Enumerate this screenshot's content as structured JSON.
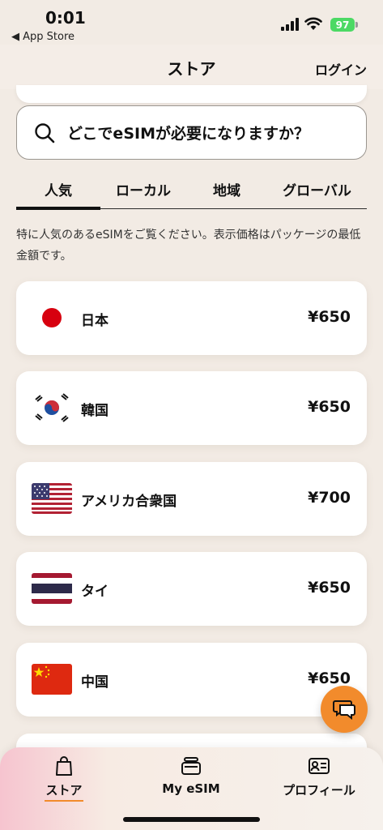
{
  "status_bar": {
    "time": "0:01",
    "back_label": "◀ App Store",
    "battery": "97"
  },
  "nav": {
    "title": "ストア",
    "login": "ログイン"
  },
  "search": {
    "placeholder": "どこでeSIMが必要になりますか？"
  },
  "tabs": [
    {
      "label": "人気",
      "active": true
    },
    {
      "label": "ローカル",
      "active": false
    },
    {
      "label": "地域",
      "active": false
    },
    {
      "label": "グローバル",
      "active": false
    }
  ],
  "description": "特に人気のあるeSIMをご覧ください。表示価格はパッケージの最低金額です。",
  "countries": [
    {
      "name": "日本",
      "price": "¥650"
    },
    {
      "name": "韓国",
      "price": "¥650"
    },
    {
      "name": "アメリカ合衆国",
      "price": "¥700"
    },
    {
      "name": "タイ",
      "price": "¥650"
    },
    {
      "name": "中国",
      "price": "¥650"
    }
  ],
  "tabbar": [
    {
      "label": "ストア",
      "icon": "shopping-bag-icon",
      "active": true
    },
    {
      "label": "My eSIM",
      "icon": "sim-stack-icon",
      "active": false
    },
    {
      "label": "プロフィール",
      "icon": "id-card-icon",
      "active": false
    }
  ],
  "colors": {
    "accent": "#f28b2c",
    "background": "#f2ebe4"
  }
}
